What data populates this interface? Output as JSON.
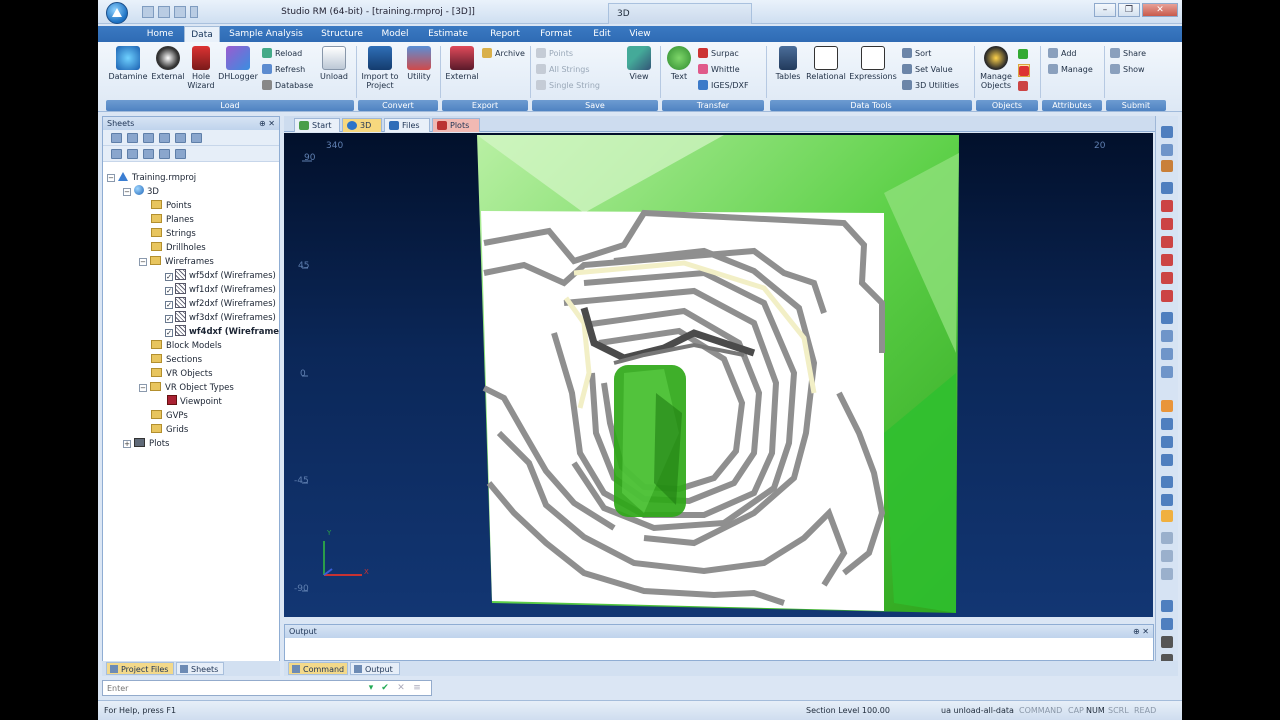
{
  "window": {
    "title": "Studio RM (64-bit) - [training.rmproj - [3D]]",
    "context_tab": "3D",
    "controls": [
      "–",
      "❐",
      "✕"
    ]
  },
  "menu": {
    "tabs": [
      "Home",
      "Data",
      "Sample Analysis",
      "Structure",
      "Model",
      "Estimate",
      "Report",
      "Format",
      "Edit",
      "View"
    ],
    "active": "Data"
  },
  "ribbon": {
    "load": {
      "label": "Load",
      "items": [
        "Datamine",
        "External",
        "Hole Wizard",
        "DHLogger"
      ],
      "small": [
        "Reload",
        "Refresh",
        "Database"
      ],
      "unload": "Unload"
    },
    "convert": {
      "label": "Convert",
      "items": [
        "Import to Project",
        "Utility"
      ]
    },
    "export": {
      "label": "Export",
      "items": [
        "External"
      ],
      "small": [
        "Archive"
      ]
    },
    "save": {
      "label": "Save",
      "small": [
        "Points",
        "All Strings",
        "Single String"
      ],
      "view": "View"
    },
    "transfer": {
      "label": "Transfer",
      "text": "Text",
      "small": [
        "Surpac",
        "Whittle",
        "IGES/DXF"
      ]
    },
    "data_tools": {
      "label": "Data Tools",
      "items": [
        "Tables",
        "Relational",
        "Expressions"
      ],
      "small": [
        "Sort",
        "Set Value",
        "3D Utilities"
      ]
    },
    "objects": {
      "label": "Objects",
      "items": [
        "Manage Objects"
      ]
    },
    "attributes": {
      "label": "Attributes",
      "small": [
        "Add",
        "Manage"
      ]
    },
    "submit": {
      "label": "Submit",
      "small": [
        "Share",
        "Show"
      ]
    }
  },
  "sheets_panel": {
    "title": "Sheets",
    "tree": {
      "project": "Training.rmproj",
      "root": "3D",
      "folders": [
        "Points",
        "Planes",
        "Strings",
        "Drillholes",
        "Wireframes"
      ],
      "wireframes": [
        "wf5dxf (Wireframes)",
        "wf1dxf (Wireframes)",
        "wf2dxf (Wireframes)",
        "wf3dxf (Wireframes)",
        "wf4dxf (Wireframe"
      ],
      "more_folders": [
        "Block Models",
        "Sections",
        "VR Objects",
        "VR Object Types"
      ],
      "viewpoint": "Viewpoint",
      "tail_folders": [
        "GVPs",
        "Grids"
      ],
      "plots": "Plots"
    },
    "bottom_tabs": [
      "Project Files",
      "Sheets"
    ]
  },
  "doc_tabs": [
    "Start",
    "3D",
    "Files",
    "Plots"
  ],
  "viewport": {
    "axis_top": [
      "340",
      "20"
    ],
    "axis_left": [
      "90",
      "45",
      "0",
      "-45",
      "-90"
    ],
    "triad": {
      "x": "X",
      "y": "Y"
    },
    "colors": {
      "background": "#0b2758",
      "surface_green": "#3fbf2f",
      "contour_grey": "#8c8c8c",
      "pit_white": "#ffffff"
    }
  },
  "output_panel": {
    "title": "Output",
    "tabs": [
      "Command",
      "Output"
    ]
  },
  "command_line": {
    "placeholder": "Enter"
  },
  "status": {
    "help": "For Help, press F1",
    "section": "Section Level 100.00",
    "command": "ua unload-all-data",
    "flags": [
      "COMMAND",
      "CAP",
      "NUM",
      "SCRL",
      "READ"
    ]
  }
}
